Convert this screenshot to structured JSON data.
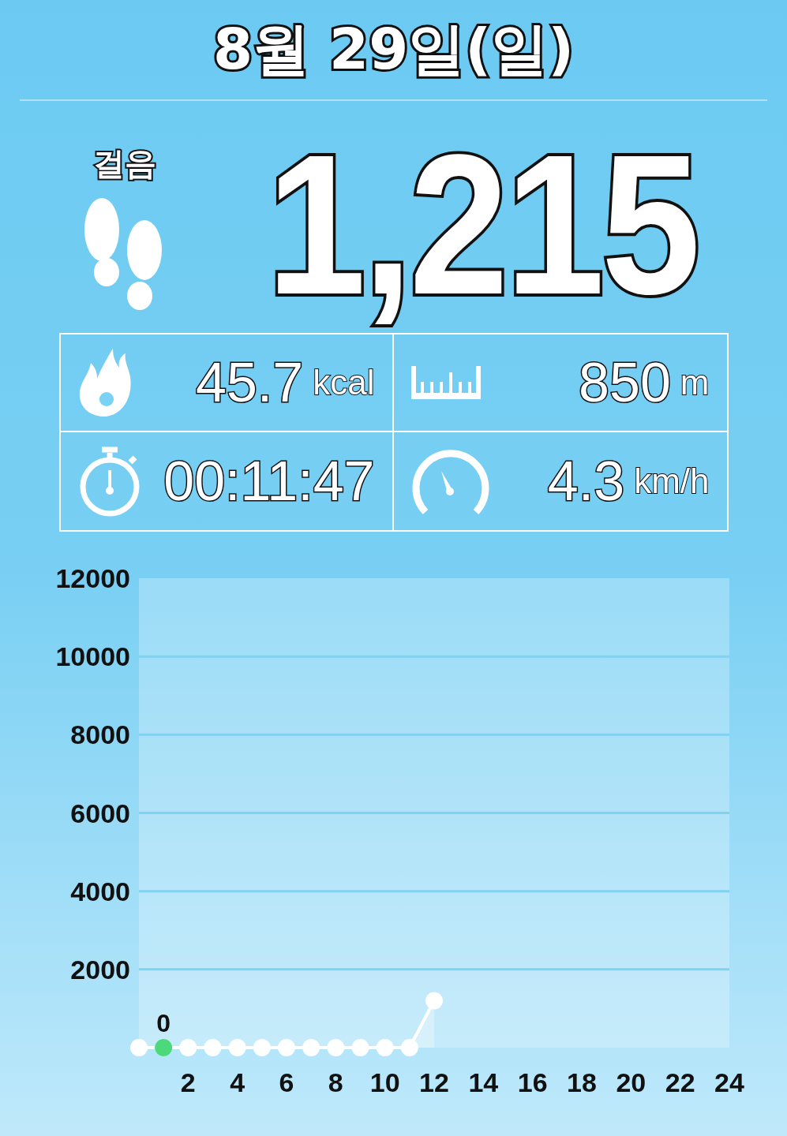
{
  "date_title": "8월 29일(일)",
  "steps": {
    "label": "걸음",
    "value": "1,215"
  },
  "stats": [
    {
      "kind": "calories",
      "value": "45.7",
      "unit": "kcal"
    },
    {
      "kind": "distance",
      "value": "850",
      "unit": "m"
    },
    {
      "kind": "duration",
      "value": "00:11:47"
    },
    {
      "kind": "speed",
      "value": "4.3",
      "unit": "km/h"
    }
  ],
  "chart": {
    "chart_data": {
      "type": "area",
      "x": [
        0,
        1,
        2,
        3,
        4,
        5,
        6,
        7,
        8,
        9,
        10,
        11,
        12
      ],
      "series": [
        {
          "color": "#ffffff",
          "values": [
            0,
            0,
            0,
            0,
            0,
            0,
            0,
            0,
            0,
            0,
            0,
            0,
            1200
          ]
        }
      ],
      "grid": true,
      "xlim": [
        0,
        24
      ],
      "ylim": [
        0,
        12000
      ],
      "xticks": [
        2,
        4,
        6,
        8,
        10,
        12,
        14,
        16,
        18,
        20,
        22,
        24
      ],
      "yticks": [
        2000,
        4000,
        6000,
        8000,
        10000,
        12000
      ],
      "annotations": [
        {
          "x": 1,
          "y": 0,
          "text": "0"
        }
      ]
    }
  }
}
